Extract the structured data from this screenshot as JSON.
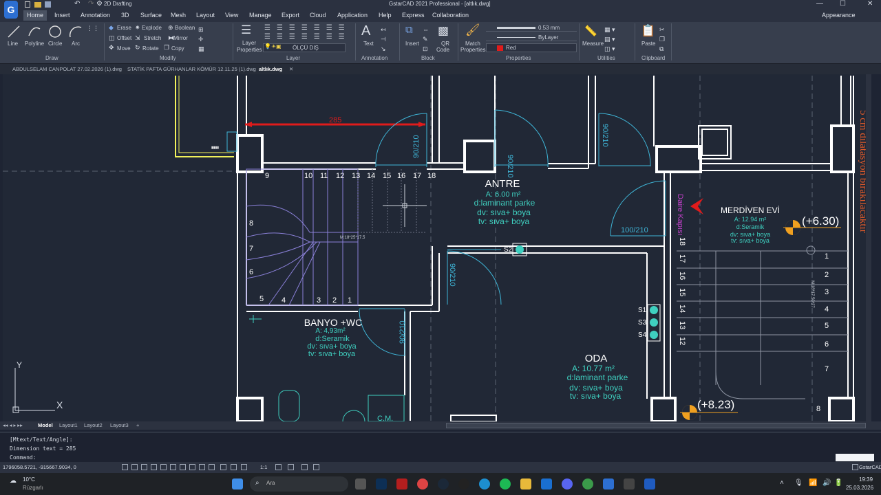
{
  "titlebar": {
    "workspace": "2D Drafting",
    "title": "GstarCAD 2021 Professional - [altlık.dwg]"
  },
  "menubar": {
    "tabs": [
      "Home",
      "Insert",
      "Annotation",
      "3D",
      "Surface",
      "Mesh",
      "Layout",
      "View",
      "Manage",
      "Export",
      "Cloud",
      "Application",
      "Help",
      "Express",
      "Collaboration"
    ],
    "appearance": "Appearance"
  },
  "ribbon": {
    "draw": {
      "line": "Line",
      "polyline": "Polyline",
      "circle": "Circle",
      "arc": "Arc",
      "group": "Draw"
    },
    "modify": {
      "erase": "Erase",
      "explode": "Explode",
      "boolean": "Boolean",
      "offset": "Offset",
      "stretch": "Stretch",
      "mirror": "Mirror",
      "move": "Move",
      "rotate": "Rotate",
      "copy": "Copy",
      "group": "Modify"
    },
    "layer": {
      "properties": "Layer",
      "properties2": "Properties",
      "current": "ÖLÇÜ DIŞ",
      "group": "Layer"
    },
    "annotation": {
      "text": "Text",
      "group": "Annotation"
    },
    "block": {
      "insert": "Insert",
      "qr": "QR",
      "qr2": "Code",
      "group": "Block"
    },
    "properties": {
      "match": "Match",
      "match2": "Properties",
      "lineweight": "0.53 mm",
      "linetype": "ByLayer",
      "color": "Red",
      "group": "Properties"
    },
    "utilities": {
      "measure": "Measure",
      "group": "Utilities"
    },
    "clipboard": {
      "paste": "Paste",
      "group": "Clipboard"
    }
  },
  "doctabs": [
    "ABDULSELAM CANPOLAT 27.02.2026 (1).dwg",
    "STATİK PAFTA GÜRHANLAR KÖMÜR 12.11.25 (1).dwg",
    "altlık.dwg"
  ],
  "drawing": {
    "dim_285": "285",
    "antre": {
      "name": "ANTRE",
      "area": "A: 6.00 m²",
      "floor": "d:laminant parke",
      "wall": "dv: sıva+ boya",
      "ceiling": "tv: sıva+ boya"
    },
    "banyo": {
      "name": "BANYO +WC",
      "area": "A: 4,93m²",
      "floor": "d:Seramik",
      "wall": "dv: sıva+ boya",
      "ceiling": "tv: sıva+ boya"
    },
    "oda": {
      "name": "ODA",
      "area": "A: 10.77 m²",
      "floor": "d:laminant parke",
      "wall": "dv: sıva+ boya",
      "ceiling": "tv: sıva+ boya"
    },
    "merdiven": {
      "name": "MERDİVEN EVİ",
      "area": "A: 12.94 m²",
      "floor": "d:Seramik",
      "wall": "dv: sıva+ boya",
      "ceiling": "tv: sıva+ boya"
    },
    "door_90_210": "90/210",
    "door_100_210": "100/210",
    "level_630": "(+6.30)",
    "level_823": "(+8.23)",
    "side_note": "5 cm dilatasyon bırakılacaktır",
    "daire_kapisi": "Daire Kapısı",
    "stair_steps_top": [
      "9",
      "10",
      "11",
      "12",
      "13",
      "14",
      "15",
      "16",
      "17",
      "18"
    ],
    "stair_steps_left": [
      "8",
      "7",
      "6"
    ],
    "stair_steps_bottom": [
      "5",
      "4",
      "3",
      "2",
      "1"
    ],
    "stair_right_left_col": [
      "18",
      "17",
      "16",
      "15",
      "14",
      "13",
      "12"
    ],
    "stair_right_right_col": [
      "1",
      "2",
      "3",
      "4",
      "5",
      "6",
      "7",
      "8"
    ],
    "stair_m": "M:18*25*17.5",
    "stair_m2": "M:18*17.50*27",
    "s_labels": [
      "S1",
      "S3",
      "S4"
    ],
    "s2": "S2",
    "cm": "C.M.",
    "axis_y": "Y",
    "axis_x": "X"
  },
  "layouts": [
    "Model",
    "Layout1",
    "Layout2",
    "Layout3"
  ],
  "command": {
    "line1": "[Mtext/Text/Angle]:",
    "line2": "Dimension text = 285",
    "line3": "Command:"
  },
  "status": {
    "coords": "1796058.5721, -915667.9034, 0",
    "scale": "1:1",
    "app": "GstarCAD"
  },
  "taskbar": {
    "weather_temp": "10°C",
    "weather_desc": "Rüzgarlı",
    "search": "Ara",
    "time": "19:39",
    "date": "25.03.2026"
  },
  "colors": {
    "wall": "#ffffff",
    "dim": "#e01b1b",
    "room_text": "#3fd0c0",
    "door": "#3fb6d8",
    "stair": "#8a80d8",
    "note": "#e05a2a",
    "magenta": "#c040c8",
    "level": "#f0a020"
  }
}
